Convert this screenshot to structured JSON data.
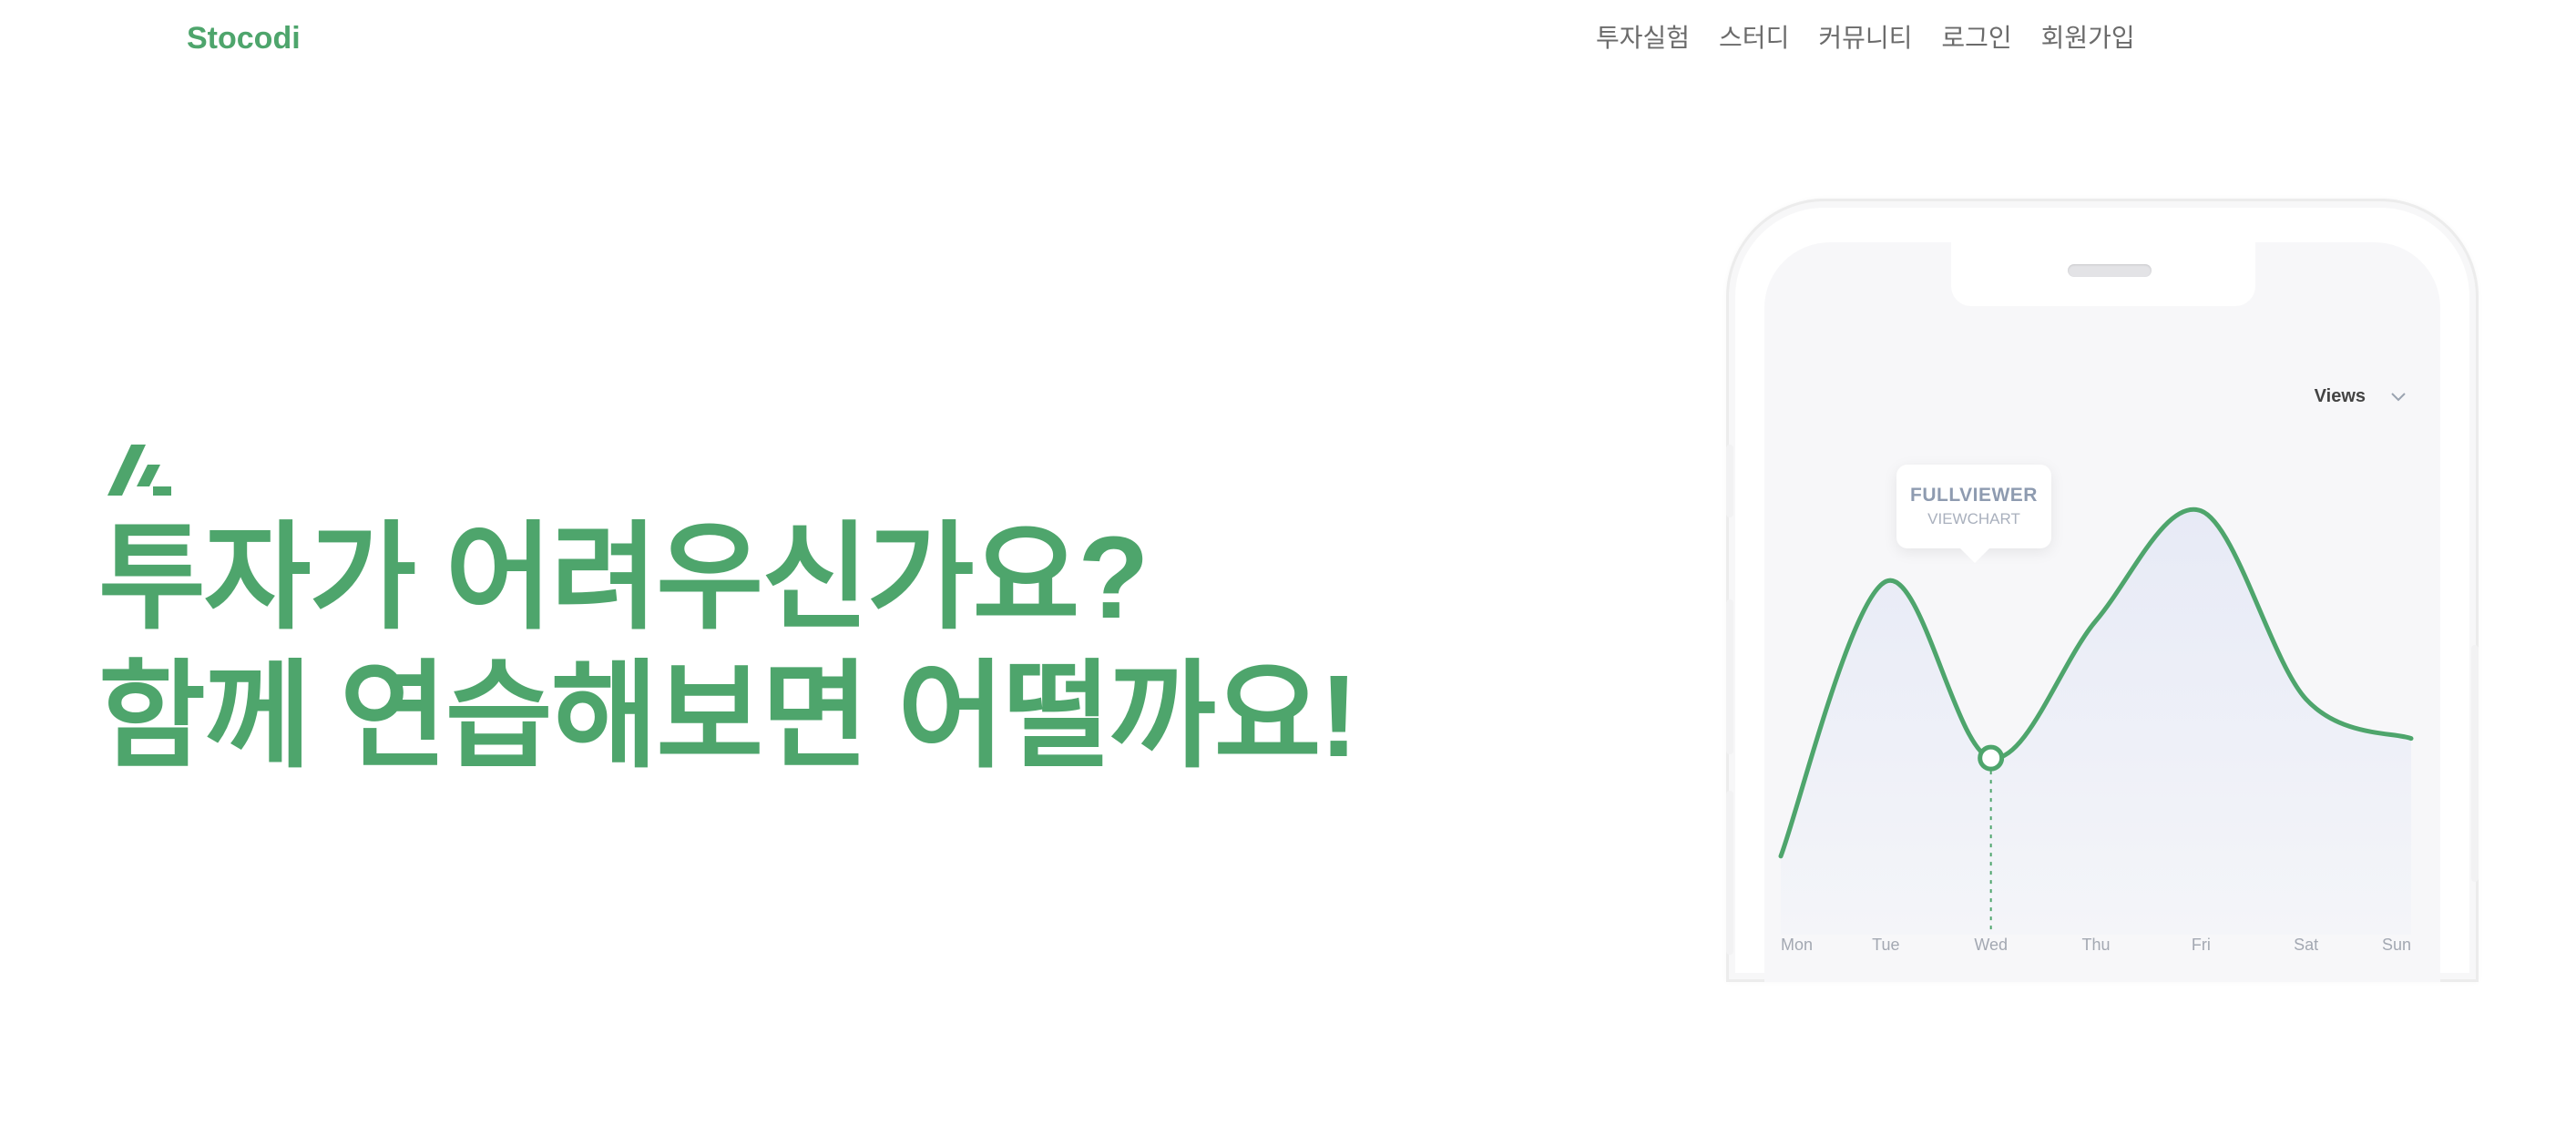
{
  "nav": {
    "logo": "Stocodi",
    "links": [
      "투자실험",
      "스터디",
      "커뮤니티",
      "로그인",
      "회원가입"
    ]
  },
  "hero": {
    "line1": "투자가 어려우신가요?",
    "line2": "함께 연습해보면 어떨까요!"
  },
  "phone": {
    "dropdown_label": "Views",
    "tooltip_title": "FULLVIEWER",
    "tooltip_subtitle": "VIEWCHART"
  },
  "colors": {
    "brand_green": "#4ea56c",
    "nav_text": "#6b6b6b"
  },
  "chart_data": {
    "type": "line",
    "categories": [
      "Mon",
      "Tue",
      "Wed",
      "Thu",
      "Fri",
      "Sat",
      "Sun"
    ],
    "series": [
      {
        "values": [
          20,
          90,
          45,
          80,
          108,
          60,
          50
        ]
      }
    ],
    "highlight_index": 2,
    "ylim": [
      0,
      130
    ],
    "grid": false,
    "legend": "none"
  }
}
